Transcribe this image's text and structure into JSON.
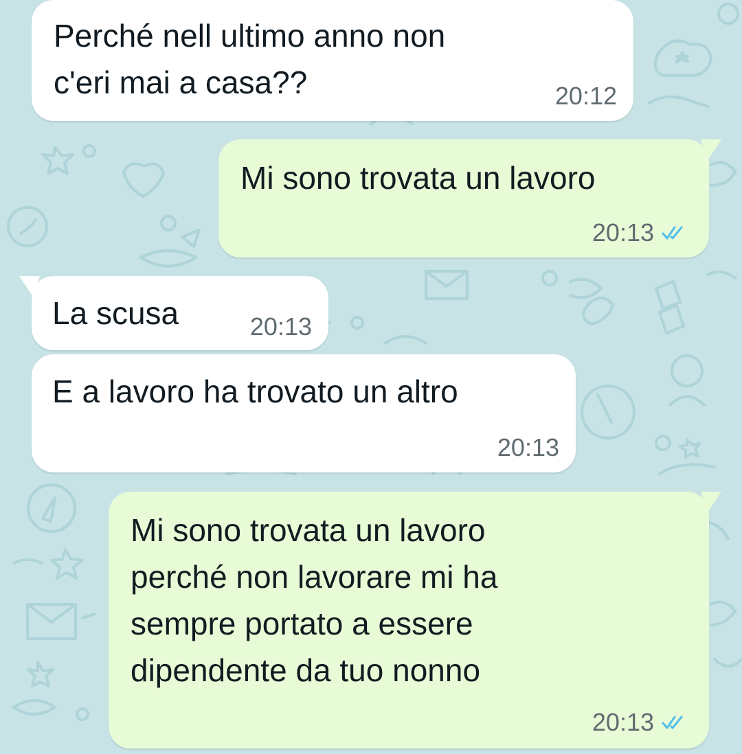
{
  "messages": [
    {
      "direction": "incoming",
      "lines": [
        "Perché nell ultimo anno non",
        "c'eri mai a casa??"
      ],
      "time": "20:12"
    },
    {
      "direction": "outgoing",
      "lines": [
        "Mi sono trovata un lavoro"
      ],
      "time": "20:13",
      "status": "read"
    },
    {
      "direction": "incoming",
      "lines": [
        "La scusa"
      ],
      "time": "20:13"
    },
    {
      "direction": "incoming",
      "lines": [
        "E a lavoro ha trovato un altro"
      ],
      "time": "20:13"
    },
    {
      "direction": "outgoing",
      "lines": [
        "Mi sono trovata un lavoro",
        "perché non lavorare mi ha",
        "sempre portato a essere",
        "dipendente da tuo nonno"
      ],
      "time": "20:13",
      "status": "read"
    }
  ],
  "colors": {
    "wallpaper": "#c7e3e6",
    "incoming_bubble": "#ffffff",
    "outgoing_bubble": "#e7fcd6",
    "read_ticks": "#53bdeb",
    "text": "#111b21",
    "time": "#5f6b70"
  },
  "icons": {
    "read_status": "double-check-icon"
  }
}
